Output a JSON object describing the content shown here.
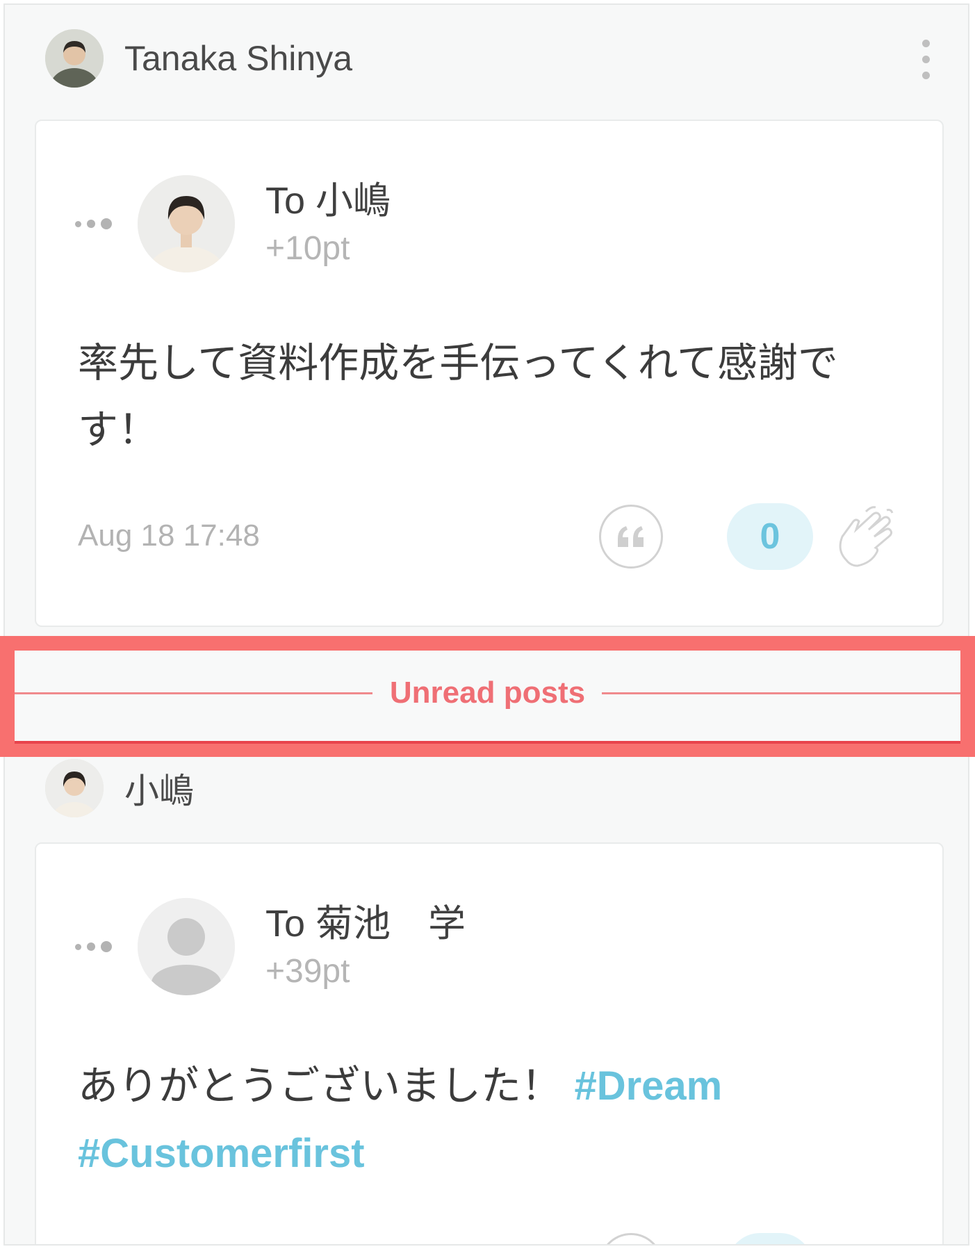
{
  "posts": [
    {
      "author": "Tanaka Shinya",
      "recipient": "To 小嶋",
      "points": "+10pt",
      "message": "率先して資料作成を手伝ってくれて感謝です！",
      "hashtags": [],
      "timestamp": "Aug 18 17:48",
      "clap_count": "0"
    },
    {
      "author": "小嶋",
      "recipient": "To 菊池　学",
      "points": "+39pt",
      "message": "ありがとうございました！",
      "hashtags": [
        "#Dream",
        "#Customerfirst"
      ],
      "timestamp": "",
      "clap_count": ""
    }
  ],
  "divider": {
    "label": "Unread posts"
  },
  "icons": {
    "more": "more-vertical-icon",
    "gift_dots": "ellipsis-icon",
    "quote": "quote-icon",
    "clap": "clap-icon",
    "default_avatar": "person-placeholder-icon"
  },
  "colors": {
    "accent_blue": "#69c3dd",
    "badge_bg": "#e2f4f9",
    "unread_red": "#ef6f75",
    "highlight_frame": "#f8706f"
  }
}
